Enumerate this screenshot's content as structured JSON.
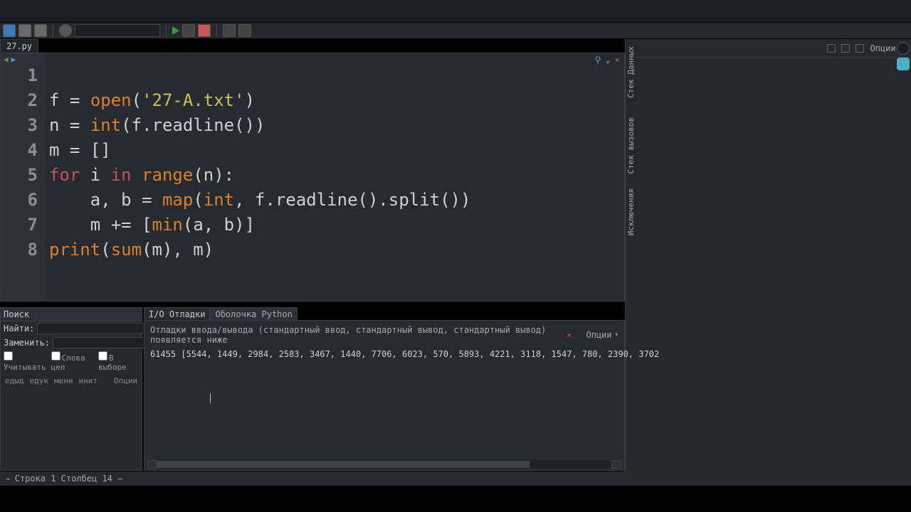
{
  "file_tab": "27.py",
  "right_options_label": "Опции",
  "side_labels": {
    "data_stack": "Стек Данных",
    "call_stack": "Стек вызовов",
    "exceptions": "Исключения"
  },
  "code_lines": 8,
  "code": {
    "l1": {
      "a": "f ",
      "eq": "= ",
      "fn": "open",
      "p1": "(",
      "str": "'27-A.txt'",
      "p2": ")"
    },
    "l2": {
      "a": "n ",
      "eq": "= ",
      "fn": "int",
      "p1": "(",
      "mid": "f.readline()",
      "p2": ")"
    },
    "l3": {
      "a": "m ",
      "eq": "= ",
      "brk": "[]"
    },
    "l4": {
      "kw1": "for",
      "sp1": " i ",
      "kw2": "in",
      "sp2": " ",
      "fn": "range",
      "p1": "(",
      "arg": "n",
      "p2": "):"
    },
    "l5": {
      "ind": "    ",
      "lhs": "a, b ",
      "eq": "= ",
      "fn": "map",
      "p1": "(",
      "b1": "int",
      "mid": ", f.readline().split()",
      "p2": ")"
    },
    "l6": {
      "ind": "    ",
      "lhs": "m ",
      "op": "+= ",
      "p1": "[",
      "fn": "min",
      "p2": "(a, b)]"
    },
    "l7": {
      "fn": "print",
      "p1": "(",
      "b1": "sum",
      "mid": "(m), m",
      "p2": ")"
    }
  },
  "search": {
    "title": "Поиск",
    "find_label": "Найти:",
    "replace_label": "Заменить:",
    "chk_case": "Учитывать",
    "chk_word": "Слова цел",
    "chk_sel": "В выборе",
    "btns": {
      "prev": "едыд",
      "next": "едук",
      "repl": "мени",
      "init": "инит"
    },
    "opts": "Опции"
  },
  "bottom_tabs": {
    "debug_io": "I/O Отладки",
    "py_shell": "Оболочка Python"
  },
  "debug": {
    "header": "Отладки ввода/вывода (стандартный ввод, стандартный вывод, стандартный вывод) появляется ниже",
    "options": "Опции",
    "output": "61455 [5544, 1449, 2984, 2583, 3467, 1440, 7706, 6023, 570, 5893, 4221, 3118, 1547, 780, 2390, 3702"
  },
  "status": "Строка 1 Столбец 14  –"
}
